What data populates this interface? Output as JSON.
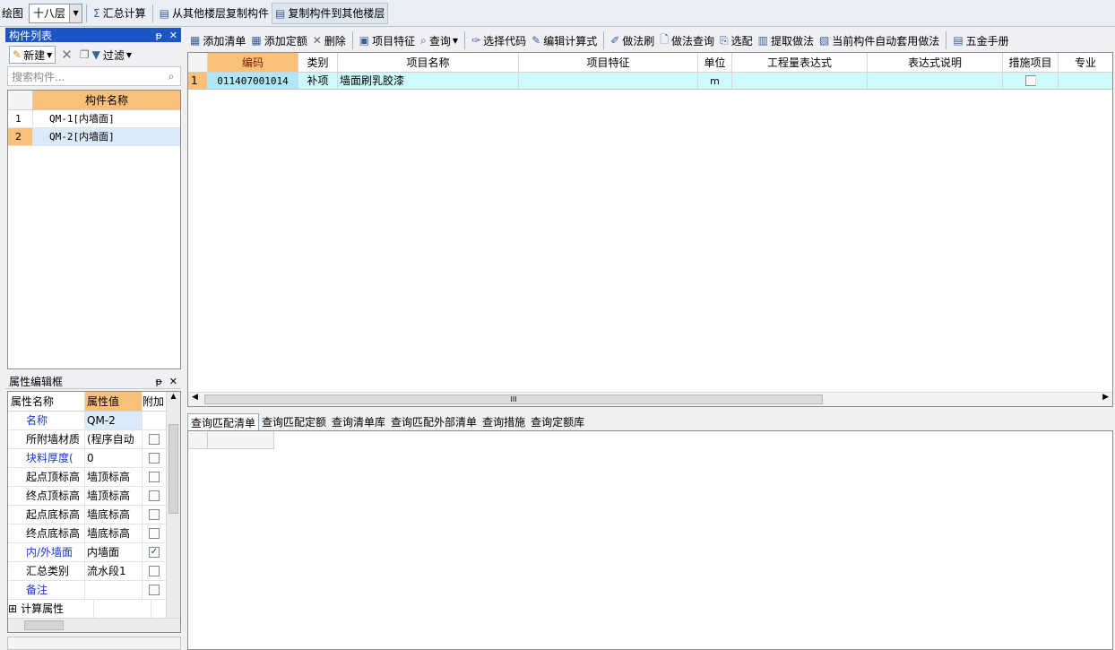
{
  "topbar": {
    "label": "绘图",
    "floor": "十八层",
    "sum_label": "汇总计算",
    "copy_from_label": "从其他楼层复制构件",
    "copy_to_label": "复制构件到其他楼层"
  },
  "component_list": {
    "title": "构件列表",
    "new_label": "新建",
    "filter_label": "过滤",
    "search_placeholder": "搜索构件...",
    "column": "构件名称",
    "rows": [
      {
        "num": "1",
        "name": "QM-1[内墙面]"
      },
      {
        "num": "2",
        "name": "QM-2[内墙面]"
      }
    ]
  },
  "property_panel": {
    "title": "属性编辑框",
    "col_name": "属性名称",
    "col_value": "属性值",
    "col_extra": "附加",
    "rows": [
      {
        "name": "名称",
        "value": "QM-2",
        "checked": null
      },
      {
        "name": "所附墙材质",
        "value": "(程序自动",
        "checked": false
      },
      {
        "name": "块料厚度(",
        "value": "0",
        "checked": false
      },
      {
        "name": "起点顶标高",
        "value": "墙顶标高",
        "checked": false
      },
      {
        "name": "终点顶标高",
        "value": "墙顶标高",
        "checked": false
      },
      {
        "name": "起点底标高",
        "value": "墙底标高",
        "checked": false
      },
      {
        "name": "终点底标高",
        "value": "墙底标高",
        "checked": false
      },
      {
        "name": "内/外墙面",
        "value": "内墙面",
        "checked": true
      },
      {
        "name": "汇总类别",
        "value": "流水段1",
        "checked": false
      },
      {
        "name": "备注",
        "value": "",
        "checked": false
      },
      {
        "name": "计算属性",
        "value": "",
        "checked": null
      }
    ]
  },
  "right_toolbar": {
    "items": [
      "添加清单",
      "添加定额",
      "删除",
      "项目特征",
      "查询",
      "选择代码",
      "编辑计算式",
      "做法刷",
      "做法查询",
      "选配",
      "提取做法",
      "当前构件自动套用做法",
      "五金手册"
    ]
  },
  "main_grid": {
    "columns": [
      "编码",
      "类别",
      "项目名称",
      "项目特征",
      "单位",
      "工程量表达式",
      "表达式说明",
      "措施项目",
      "专业"
    ],
    "rows": [
      {
        "num": "1",
        "code": "011407001014",
        "type": "补项",
        "name": "墙面刷乳胶漆",
        "feature": "",
        "unit": "m",
        "expr": "",
        "desc": "",
        "measure": false,
        "major": ""
      }
    ],
    "scroll_marker": "III"
  },
  "bottom_tabs": [
    "查询匹配清单",
    "查询匹配定额",
    "查询清单库",
    "查询匹配外部清单",
    "查询措施",
    "查询定额库"
  ]
}
